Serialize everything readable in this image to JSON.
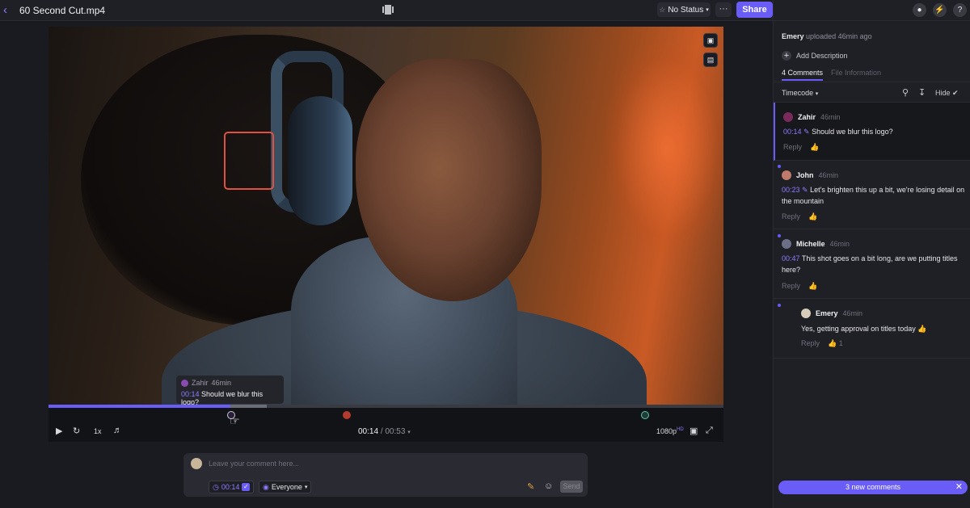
{
  "header": {
    "file_title": "60 Second Cut.mp4",
    "status_label": "No Status",
    "more_label": "···",
    "share_label": "Share"
  },
  "player": {
    "tooltip": {
      "author": "Zahir",
      "age": "46min",
      "timecode": "00:14",
      "text": "Should we blur this logo?"
    },
    "playhead_fraction": 0.269,
    "buffered_fraction": 0.323,
    "speed_label": "1x",
    "current_time": "00:14",
    "duration": "/ 00:53",
    "quality": "1080p",
    "quality_badge": "HD"
  },
  "composer": {
    "placeholder": "Leave your comment here...",
    "timecode": "00:14",
    "audience": "Everyone",
    "send_label": "Send"
  },
  "panel": {
    "uploader_name": "Emery",
    "uploader_meta": "uploaded 46min ago",
    "add_description": "Add Description",
    "tab_comments": "4 Comments",
    "tab_info": "File Information",
    "sort_label": "Timecode",
    "hide_label": "Hide",
    "comments": [
      {
        "name": "Zahir",
        "age": "46min",
        "timecode": "00:14",
        "text": "Should we blur this logo?",
        "reply": "Reply",
        "likes": ""
      },
      {
        "name": "John",
        "age": "46min",
        "timecode": "00:23",
        "text": "Let's brighten this up a bit, we're losing detail on the mountain",
        "reply": "Reply",
        "likes": ""
      },
      {
        "name": "Michelle",
        "age": "46min",
        "timecode": "00:47",
        "text": "This shot goes on a bit long, are we putting titles here?",
        "reply": "Reply",
        "likes": ""
      },
      {
        "name": "Emery",
        "age": "46min",
        "timecode": "",
        "text": "Yes, getting approval on titles today 👍",
        "reply": "Reply",
        "likes": "1"
      }
    ],
    "new_comments_label": "3 new comments"
  },
  "colors": {
    "accent": "#6a5cf6",
    "annotation": "#e0523f"
  },
  "icons": [
    "back-chevron-icon",
    "layout-toggle-icon",
    "user-icon",
    "bolt-icon",
    "help-icon",
    "play-icon",
    "loop-icon",
    "volume-icon",
    "fit-icon",
    "fullscreen-icon",
    "search-icon",
    "download-icon",
    "check-circle-icon",
    "thumbs-up-icon",
    "clock-icon",
    "draw-icon",
    "emoji-icon",
    "close-icon"
  ]
}
